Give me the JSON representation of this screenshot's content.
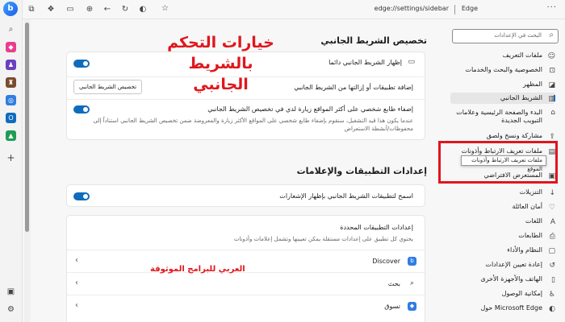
{
  "browser": {
    "address": "edge://settings/sidebar",
    "engine_label": "Edge"
  },
  "overlay": {
    "title_line1": "خيارات التحكم",
    "title_line2": "بالشريط الجانبي",
    "apps_note": "العربي للبرامج الموثوقة"
  },
  "search": {
    "placeholder": "البحث في الإعدادات"
  },
  "nav": {
    "items": [
      {
        "label": "ملفات التعريف",
        "icon": "person-icon"
      },
      {
        "label": "الخصوصية والبحث والخدمات",
        "icon": "lock-icon"
      },
      {
        "label": "المظهر",
        "icon": "appearance-icon"
      },
      {
        "label": "الشريط الجانبي",
        "icon": "sidebar-icon"
      },
      {
        "label": "البدء والصفحة الرئيسية وعلامات التبويب الجديدة",
        "icon": "home-icon"
      },
      {
        "label": "مشاركة ونسخ ولصق",
        "icon": "share-icon"
      },
      {
        "label": "ملفات تعريف الارتباط وأذونات",
        "icon": "cookie-icon"
      },
      {
        "label": "المستعرض الافتراضي",
        "icon": "browser-icon"
      },
      {
        "label": "التنزيلات",
        "icon": "download-icon"
      },
      {
        "label": "أمان العائلة",
        "icon": "family-icon"
      },
      {
        "label": "اللغات",
        "icon": "language-icon"
      },
      {
        "label": "الطابعات",
        "icon": "printer-icon"
      },
      {
        "label": "النظام والأداء",
        "icon": "system-icon"
      },
      {
        "label": "إعادة تعيين الإعدادات",
        "icon": "reset-icon"
      },
      {
        "label": "الهاتف والأجهزة الأخرى",
        "icon": "phone-icon"
      },
      {
        "label": "إمكانية الوصول",
        "icon": "accessibility-icon"
      },
      {
        "label": "حول Microsoft Edge",
        "icon": "edge-icon"
      }
    ],
    "tooltip": "ملفات تعريف الارتباط وأذونات الموقع"
  },
  "main": {
    "section1_title": "تخصيص الشريط الجانبي",
    "always_show_label": "إظهار الشريط الجانبي دائما",
    "add_remove_label": "إضافة تطبيقات أو إزالتها من الشريط الجانبي",
    "customize_button": "تخصيص الشريط الجانبي",
    "personalize_label": "إضفاء طابع شخصي على أكثر المواقع زيارة لدي في تخصيص الشريط الجانبي",
    "personalize_desc": "عندما يكون هذا قيد التشغيل، سنقوم بإضفاء طابع شخصي على المواقع الأكثر زيارة والمعروضة ضمن تخصيص الشريط الجانبي استناداً إلى محفوظات/أنشطة الاستعراض",
    "section2_title": "إعدادات التطبيقات والإعلامات",
    "notifications_label": "اسمح لتطبيقات الشريط الجانبي بإظهار الإشعارات",
    "specific_apps_title": "إعدادات التطبيقات المحددة",
    "specific_apps_desc": "يحتوي كل تطبيق على إعدادات مستقلة يمكن تعيينها وتشمل إعلامات وأذونات",
    "apps": [
      {
        "label": "Discover",
        "icon": "discover-icon"
      },
      {
        "label": "بحث",
        "icon": "search-app-icon"
      },
      {
        "label": "تسوق",
        "icon": "shopping-icon"
      }
    ]
  },
  "colors": {
    "accent": "#0f6cbd",
    "highlight": "#e0161c"
  }
}
